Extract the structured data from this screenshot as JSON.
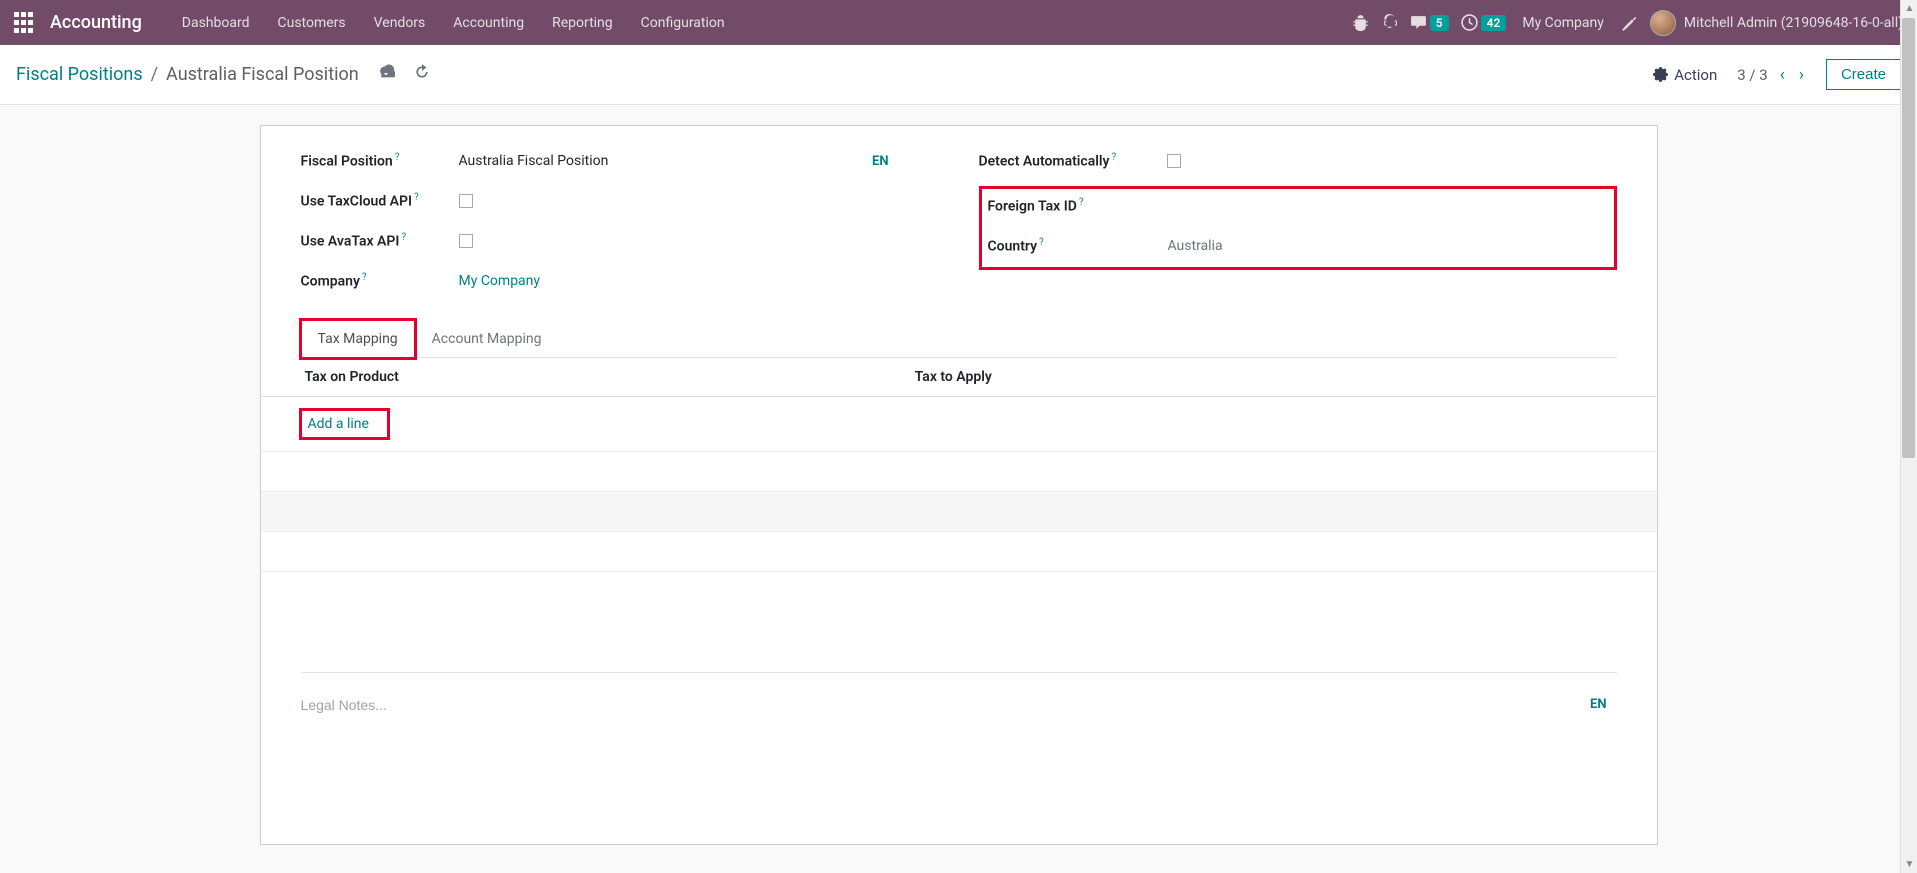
{
  "navbar": {
    "brand": "Accounting",
    "menu": [
      "Dashboard",
      "Customers",
      "Vendors",
      "Accounting",
      "Reporting",
      "Configuration"
    ],
    "badge_conv": "5",
    "badge_activity": "42",
    "company": "My Company",
    "user": "Mitchell Admin (21909648-16-0-all)"
  },
  "control": {
    "breadcrumb_parent": "Fiscal Positions",
    "breadcrumb_current": "Australia Fiscal Position",
    "action_label": "Action",
    "pager": "3 / 3",
    "create_label": "Create"
  },
  "form": {
    "left": {
      "fiscal_position_label": "Fiscal Position",
      "fiscal_position_value": "Australia Fiscal Position",
      "lang_badge": "EN",
      "use_taxcloud_label": "Use TaxCloud API",
      "use_avatax_label": "Use AvaTax API",
      "company_label": "Company",
      "company_value": "My Company"
    },
    "right": {
      "detect_auto_label": "Detect Automatically",
      "foreign_tax_label": "Foreign Tax ID",
      "country_label": "Country",
      "country_value": "Australia"
    }
  },
  "tabs": {
    "tax_mapping": "Tax Mapping",
    "account_mapping": "Account Mapping"
  },
  "table": {
    "col_tax_product": "Tax on Product",
    "col_tax_apply": "Tax to Apply",
    "add_line": "Add a line"
  },
  "notes": {
    "placeholder": "Legal Notes...",
    "lang": "EN"
  }
}
